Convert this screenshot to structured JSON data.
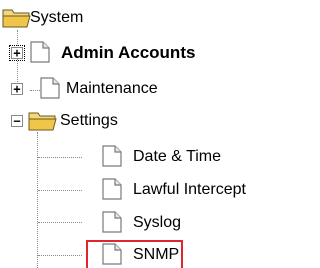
{
  "tree": {
    "root": {
      "label": "System",
      "icon": "folder-open-icon"
    },
    "items": [
      {
        "label": "Admin Accounts",
        "icon": "document-icon",
        "toggle": "+",
        "bold": true
      },
      {
        "label": "Maintenance",
        "icon": "document-icon",
        "toggle": "+"
      },
      {
        "label": "Settings",
        "icon": "folder-open-icon",
        "toggle": "−"
      },
      {
        "label": "Date & Time",
        "icon": "document-icon"
      },
      {
        "label": "Lawful Intercept",
        "icon": "document-icon"
      },
      {
        "label": "Syslog",
        "icon": "document-icon"
      },
      {
        "label": "SNMP",
        "icon": "document-icon",
        "highlighted": true
      }
    ]
  },
  "colors": {
    "folder": "#f0c64a",
    "highlight": "#e0262c"
  }
}
